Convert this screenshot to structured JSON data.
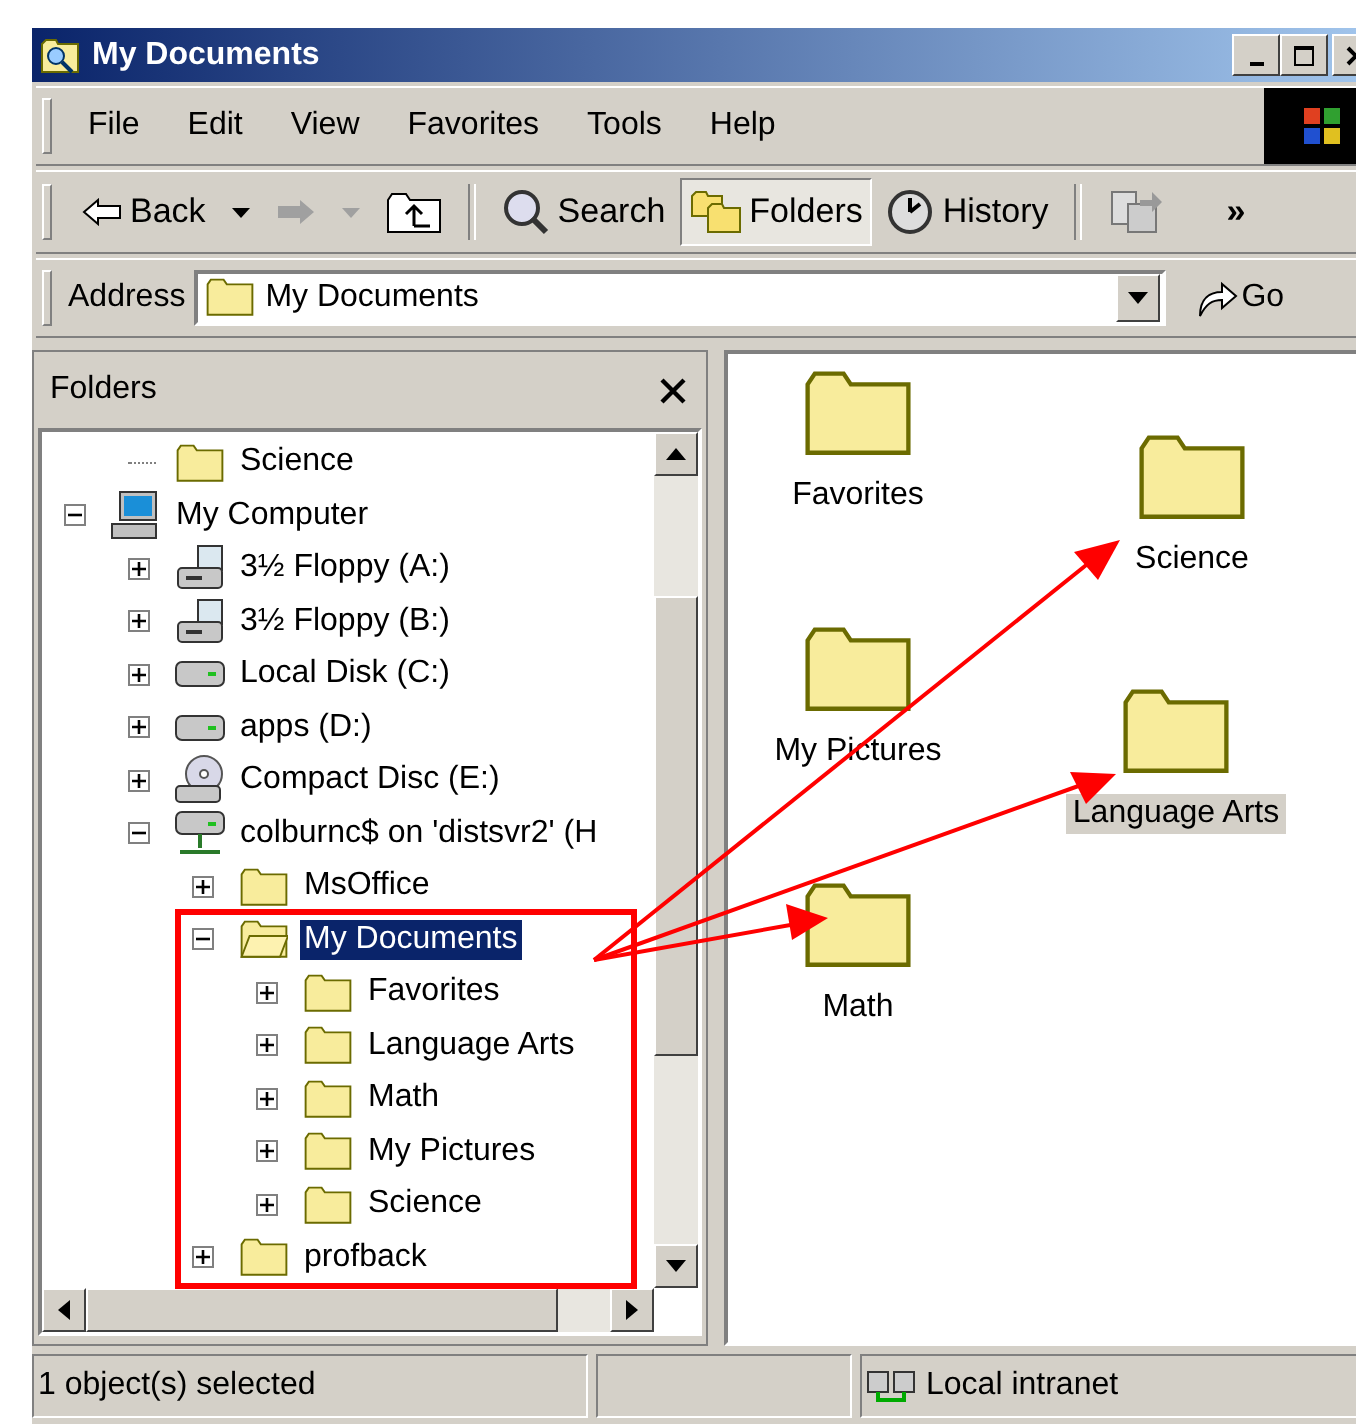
{
  "window": {
    "title": "My Documents"
  },
  "menu": [
    "File",
    "Edit",
    "View",
    "Favorites",
    "Tools",
    "Help"
  ],
  "toolbar": {
    "back": "Back",
    "search": "Search",
    "folders": {
      "label": "Folders",
      "selected": true
    },
    "history": "History",
    "forward_disabled": true,
    "overflow": "»"
  },
  "address": {
    "label": "Address",
    "value": "My Documents",
    "go": "Go"
  },
  "folders_pane": {
    "title": "Folders"
  },
  "tree": [
    {
      "label": "Science",
      "kind": "folder",
      "selected": false
    },
    {
      "label": "My Computer",
      "kind": "computer",
      "expanded": true,
      "selected": false,
      "children": [
        {
          "label": "3½ Floppy (A:)",
          "kind": "floppy",
          "expanded": false,
          "selected": false
        },
        {
          "label": "3½ Floppy (B:)",
          "kind": "floppy",
          "expanded": false,
          "selected": false
        },
        {
          "label": "Local Disk (C:)",
          "kind": "disk",
          "expanded": false,
          "selected": false
        },
        {
          "label": "apps (D:)",
          "kind": "disk",
          "expanded": false,
          "selected": false
        },
        {
          "label": "Compact Disc (E:)",
          "kind": "cd",
          "expanded": false,
          "selected": false
        },
        {
          "label": "colburnc$ on 'distsvr2' (H",
          "kind": "network",
          "expanded": true,
          "selected": false,
          "children": [
            {
              "label": "MsOffice",
              "kind": "folder",
              "expanded": false,
              "selected": false
            },
            {
              "label": "My Documents",
              "kind": "folder",
              "expanded": true,
              "selected": true,
              "children": [
                {
                  "label": "Favorites",
                  "kind": "folder",
                  "expanded": false,
                  "selected": false
                },
                {
                  "label": "Language Arts",
                  "kind": "folder",
                  "expanded": false,
                  "selected": false
                },
                {
                  "label": "Math",
                  "kind": "folder",
                  "expanded": false,
                  "selected": false
                },
                {
                  "label": "My Pictures",
                  "kind": "folder",
                  "expanded": false,
                  "selected": false
                },
                {
                  "label": "Science",
                  "kind": "folder",
                  "expanded": false,
                  "selected": false
                }
              ]
            },
            {
              "label": "profback",
              "kind": "folder",
              "expanded": false,
              "selected": false
            }
          ]
        }
      ]
    }
  ],
  "items": [
    {
      "label": "Favorites",
      "selected": false
    },
    {
      "label": "Science",
      "selected": false
    },
    {
      "label": "My Pictures",
      "selected": false
    },
    {
      "label": "Language Arts",
      "selected": true
    },
    {
      "label": "Math",
      "selected": false
    }
  ],
  "status_bar": {
    "text": "1 object(s) selected",
    "zone": "Local intranet"
  }
}
